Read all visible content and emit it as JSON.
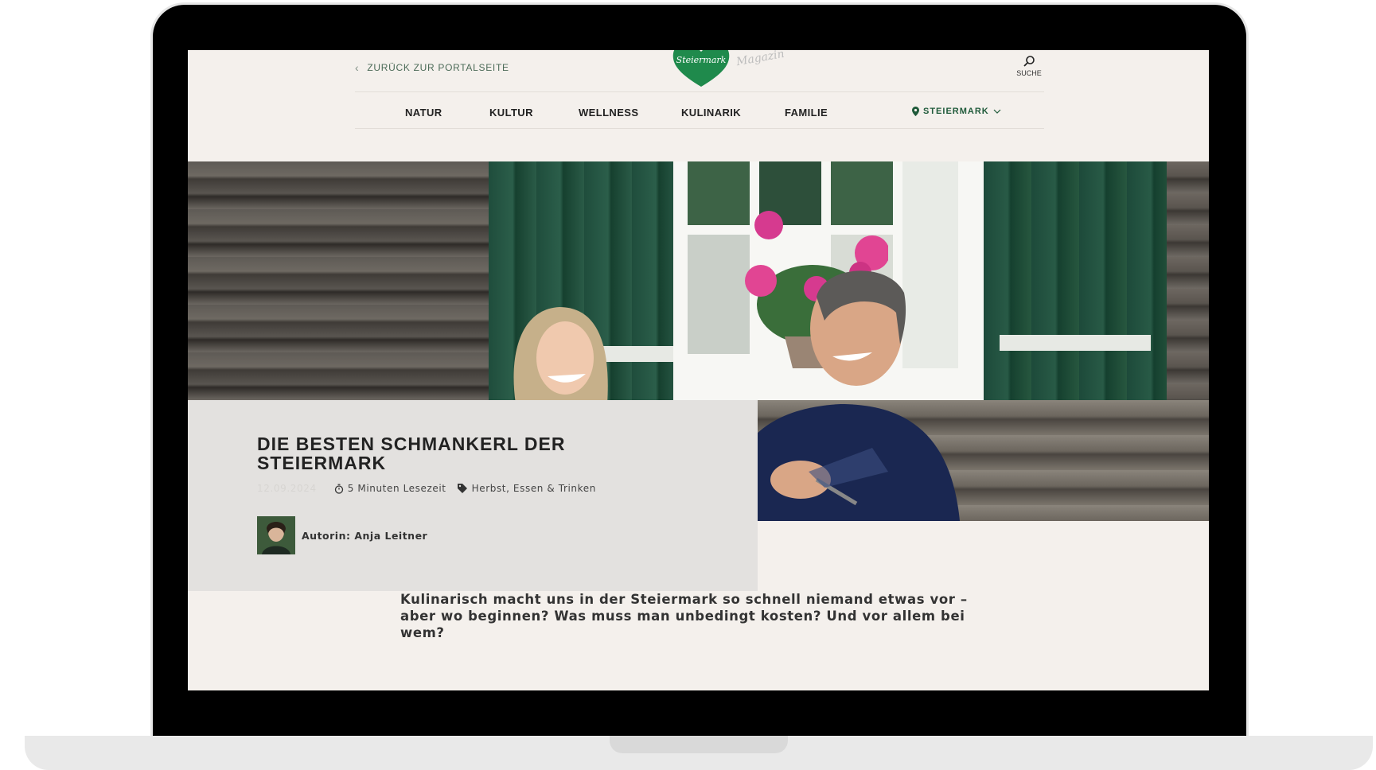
{
  "header": {
    "back_link": "ZURÜCK ZUR PORTALSEITE",
    "logo_text": "Steiermark",
    "logo_magazin": "Magazin",
    "search_label": "SUCHE"
  },
  "nav": {
    "items": [
      "NATUR",
      "KULTUR",
      "WELLNESS",
      "KULINARIK",
      "FAMILIE"
    ],
    "region": "STEIERMARK"
  },
  "article": {
    "title_line1": "DIE BESTEN SCHMANKERL DER",
    "title_line2": "STEIERMARK",
    "date": "12.09.2024",
    "read_time": "5 Minuten Lesezeit",
    "tags": "Herbst, Essen & Trinken",
    "author": "Autorin: Anja Leitner",
    "lead": "Kulinarisch macht uns in der Steiermark so schnell niemand etwas vor – aber wo beginnen? Was muss man unbedingt kosten? Und vor allem bei wem?"
  },
  "colors": {
    "brand_green": "#1f8a4c",
    "page_bg": "#f4f0ec",
    "card_bg": "#e3e1df"
  }
}
